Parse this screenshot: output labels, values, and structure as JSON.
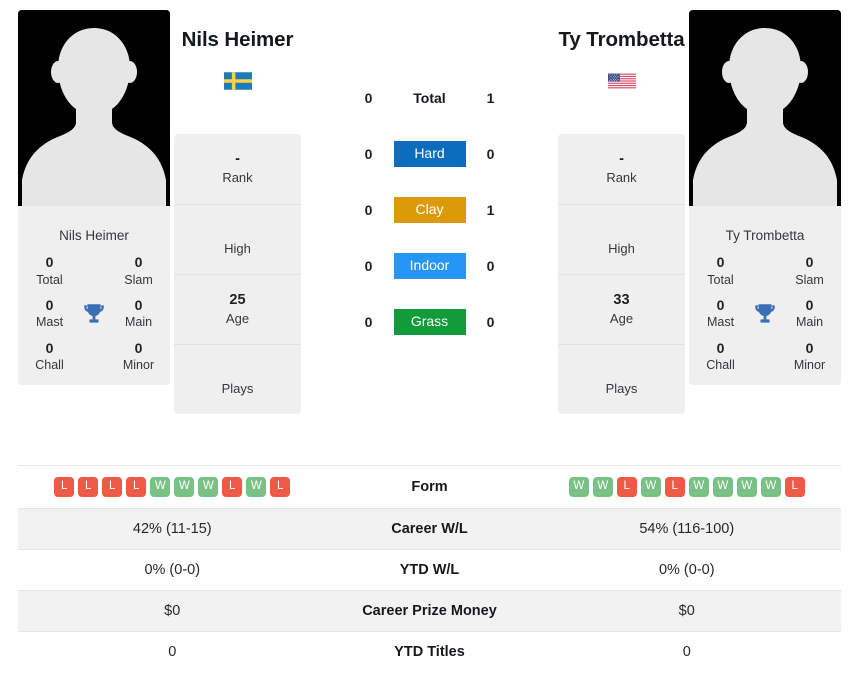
{
  "players": {
    "left": {
      "name": "Nils Heimer",
      "flag_icon": "flag-sweden",
      "flag_name": "Sweden",
      "card_name": "Nils Heimer",
      "titles": {
        "total_value": "0",
        "total_label": "Total",
        "slam_value": "0",
        "slam_label": "Slam",
        "mast_value": "0",
        "mast_label": "Mast",
        "main_value": "0",
        "main_label": "Main",
        "chall_value": "0",
        "chall_label": "Chall",
        "minor_value": "0",
        "minor_label": "Minor",
        "trophy_icon": "trophy-icon"
      },
      "info": {
        "rank_value": "-",
        "rank_label": "Rank",
        "high_value": "",
        "high_label": "High",
        "age_value": "25",
        "age_label": "Age",
        "plays_value": "",
        "plays_label": "Plays"
      },
      "form": [
        "L",
        "L",
        "L",
        "L",
        "W",
        "W",
        "W",
        "L",
        "W",
        "L"
      ],
      "stats": {
        "career_wl": "42% (11-15)",
        "ytd_wl": "0% (0-0)",
        "career_prize": "$0",
        "ytd_titles": "0"
      }
    },
    "right": {
      "name": "Ty Trombetta",
      "flag_icon": "flag-usa",
      "flag_name": "United States",
      "card_name": "Ty Trombetta",
      "titles": {
        "total_value": "0",
        "total_label": "Total",
        "slam_value": "0",
        "slam_label": "Slam",
        "mast_value": "0",
        "mast_label": "Mast",
        "main_value": "0",
        "main_label": "Main",
        "chall_value": "0",
        "chall_label": "Chall",
        "minor_value": "0",
        "minor_label": "Minor",
        "trophy_icon": "trophy-icon"
      },
      "info": {
        "rank_value": "-",
        "rank_label": "Rank",
        "high_value": "",
        "high_label": "High",
        "age_value": "33",
        "age_label": "Age",
        "plays_value": "",
        "plays_label": "Plays"
      },
      "form": [
        "W",
        "W",
        "L",
        "W",
        "L",
        "W",
        "W",
        "W",
        "W",
        "L"
      ],
      "stats": {
        "career_wl": "54% (116-100)",
        "ytd_wl": "0% (0-0)",
        "career_prize": "$0",
        "ytd_titles": "0"
      }
    }
  },
  "h2h": {
    "rows": [
      {
        "left": "0",
        "label": "Total",
        "right": "1",
        "badge": false,
        "color": ""
      },
      {
        "left": "0",
        "label": "Hard",
        "right": "0",
        "badge": true,
        "color": "#0b6dbd"
      },
      {
        "left": "0",
        "label": "Clay",
        "right": "1",
        "badge": true,
        "color": "#dd9a08"
      },
      {
        "left": "0",
        "label": "Indoor",
        "right": "0",
        "badge": true,
        "color": "#2595f6"
      },
      {
        "left": "0",
        "label": "Grass",
        "right": "0",
        "badge": true,
        "color": "#119b39"
      }
    ]
  },
  "table": {
    "form_label": "Form",
    "rows": [
      {
        "label": "Career W/L",
        "left": "42% (11-15)",
        "right": "54% (116-100)"
      },
      {
        "label": "YTD W/L",
        "left": "0% (0-0)",
        "right": "0% (0-0)"
      },
      {
        "label": "Career Prize Money",
        "left": "$0",
        "right": "$0"
      },
      {
        "label": "YTD Titles",
        "left": "0",
        "right": "0"
      }
    ]
  },
  "colors": {
    "win": "#79c185",
    "loss": "#ee5a45",
    "hard": "#0b6dbd",
    "clay": "#dd9a08",
    "indoor": "#2595f6",
    "grass": "#119b39",
    "card_bg": "#efefef",
    "row_shade": "#f2f2f2"
  }
}
